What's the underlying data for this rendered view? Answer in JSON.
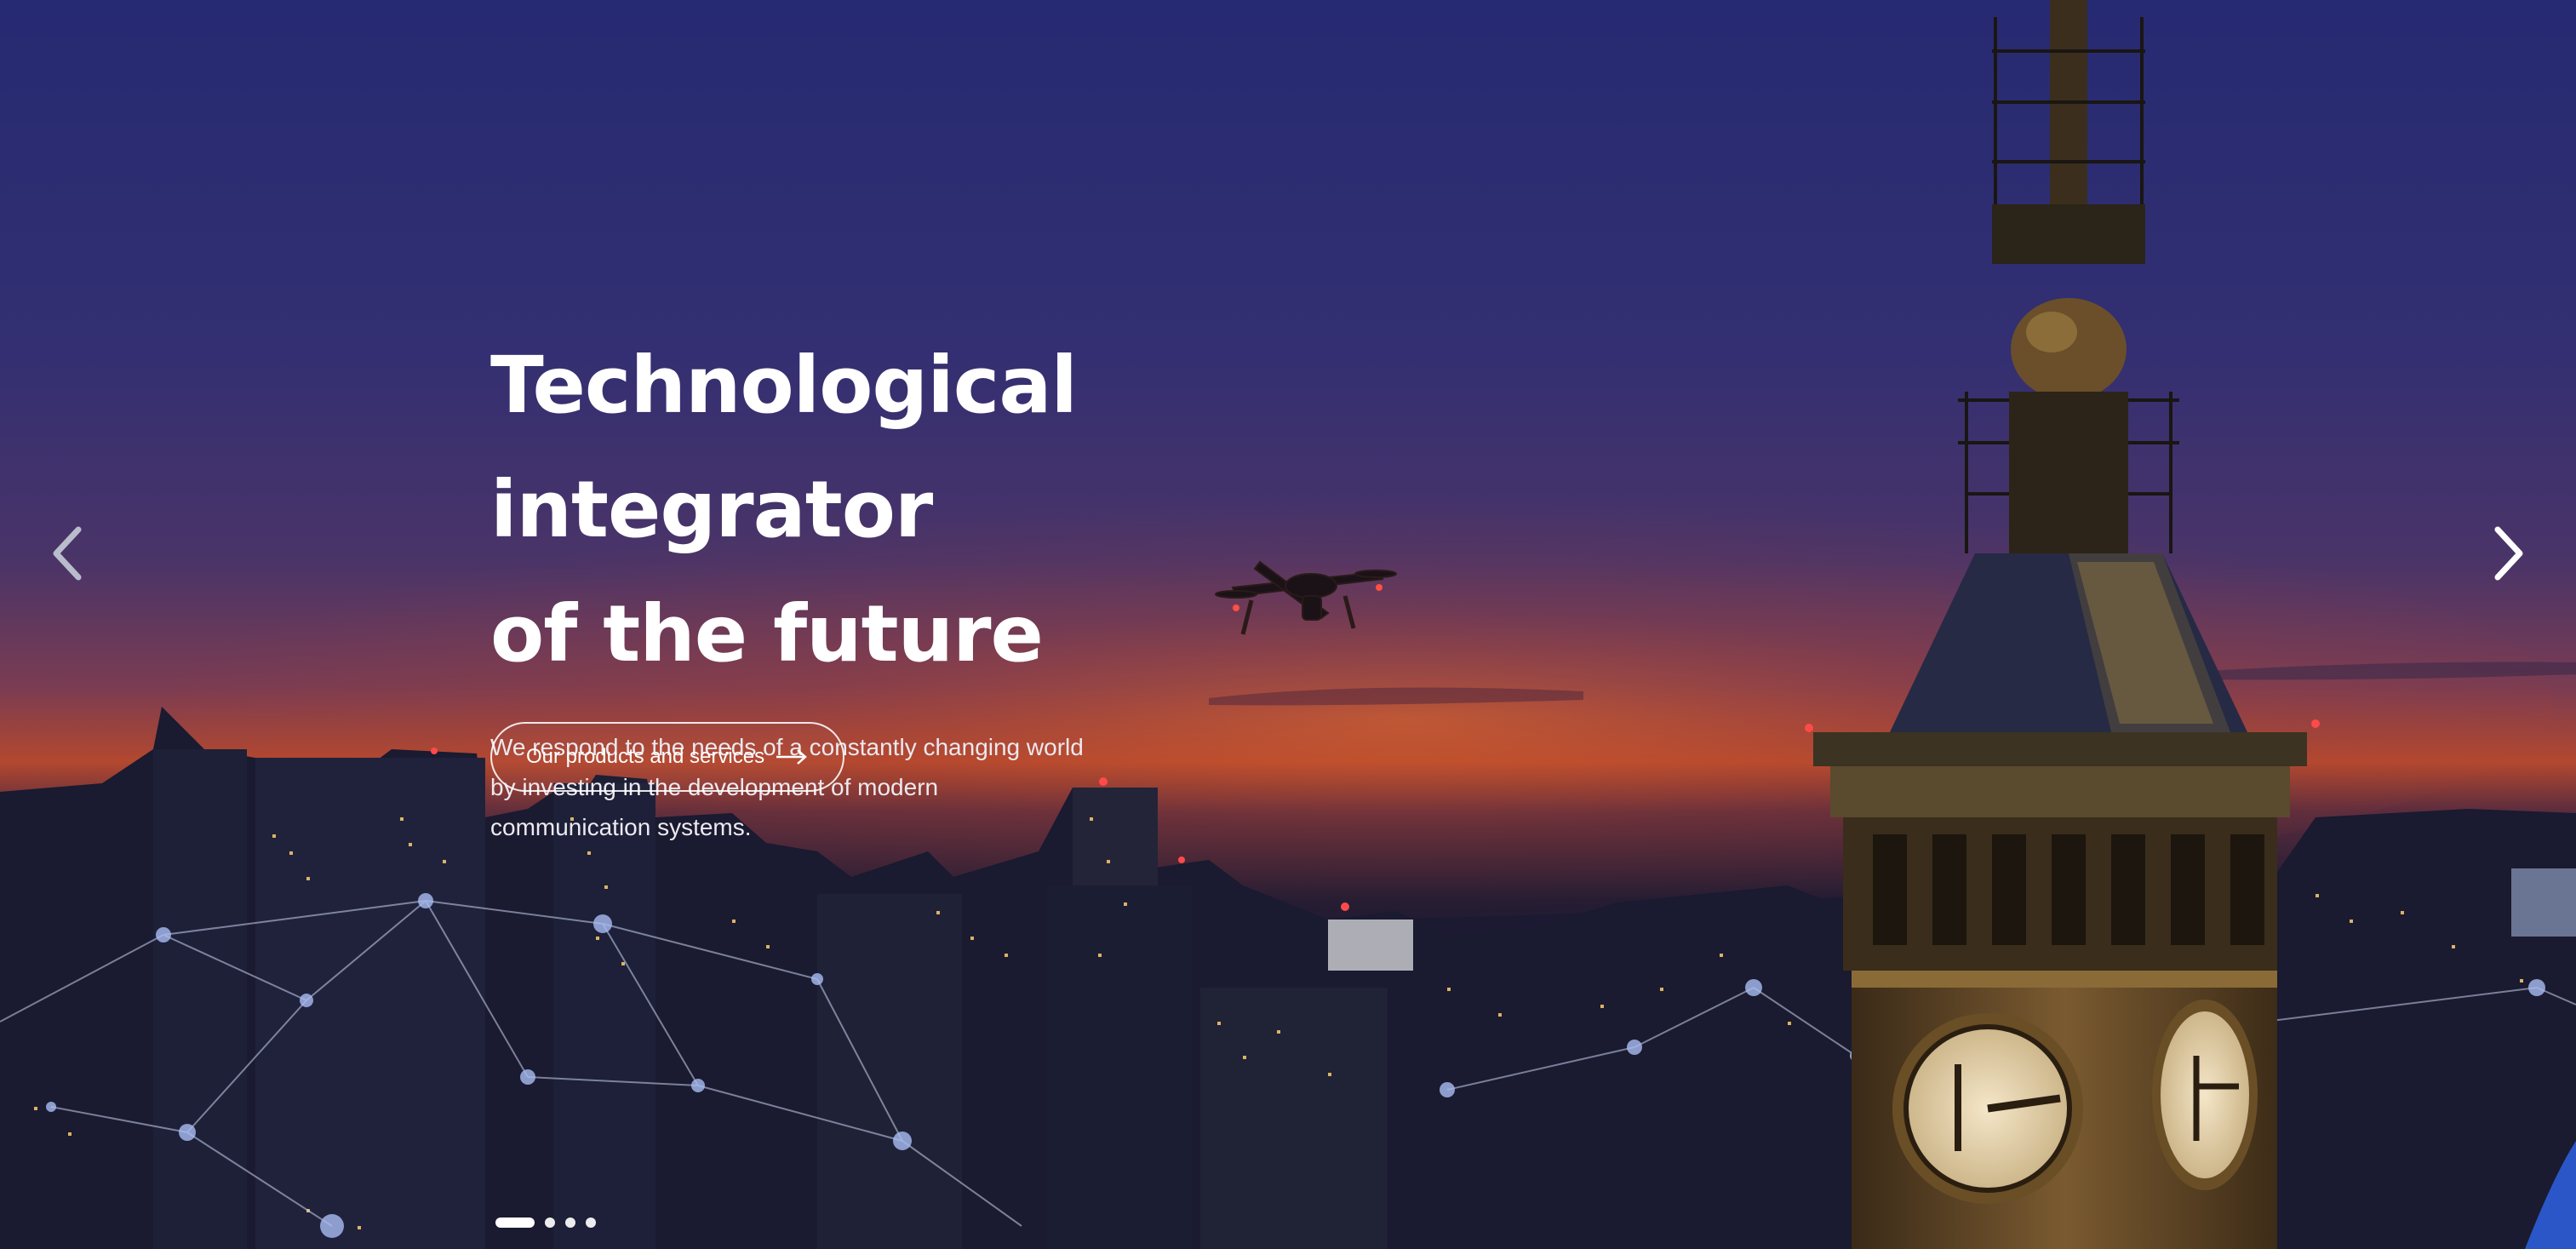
{
  "hero": {
    "title_lines": [
      "Technological integrator",
      "of the future"
    ],
    "description_lines": [
      "We respond to the needs of a constantly changing world",
      "by investing in the development of modern",
      "communication systems."
    ],
    "cta_label": "Our products and services",
    "cta_icon": "arrow-right-icon"
  },
  "carousel": {
    "prev_icon": "chevron-left-icon",
    "next_icon": "chevron-right-icon",
    "slide_count": 4,
    "active_slide": 1
  },
  "colors": {
    "sky_top": "#262a72",
    "sky_mid": "#3a2f6b",
    "sunset": "#d4572c",
    "city_dark": "#14162e",
    "accent_blue": "#2a56c8",
    "text": "#ffffff"
  }
}
